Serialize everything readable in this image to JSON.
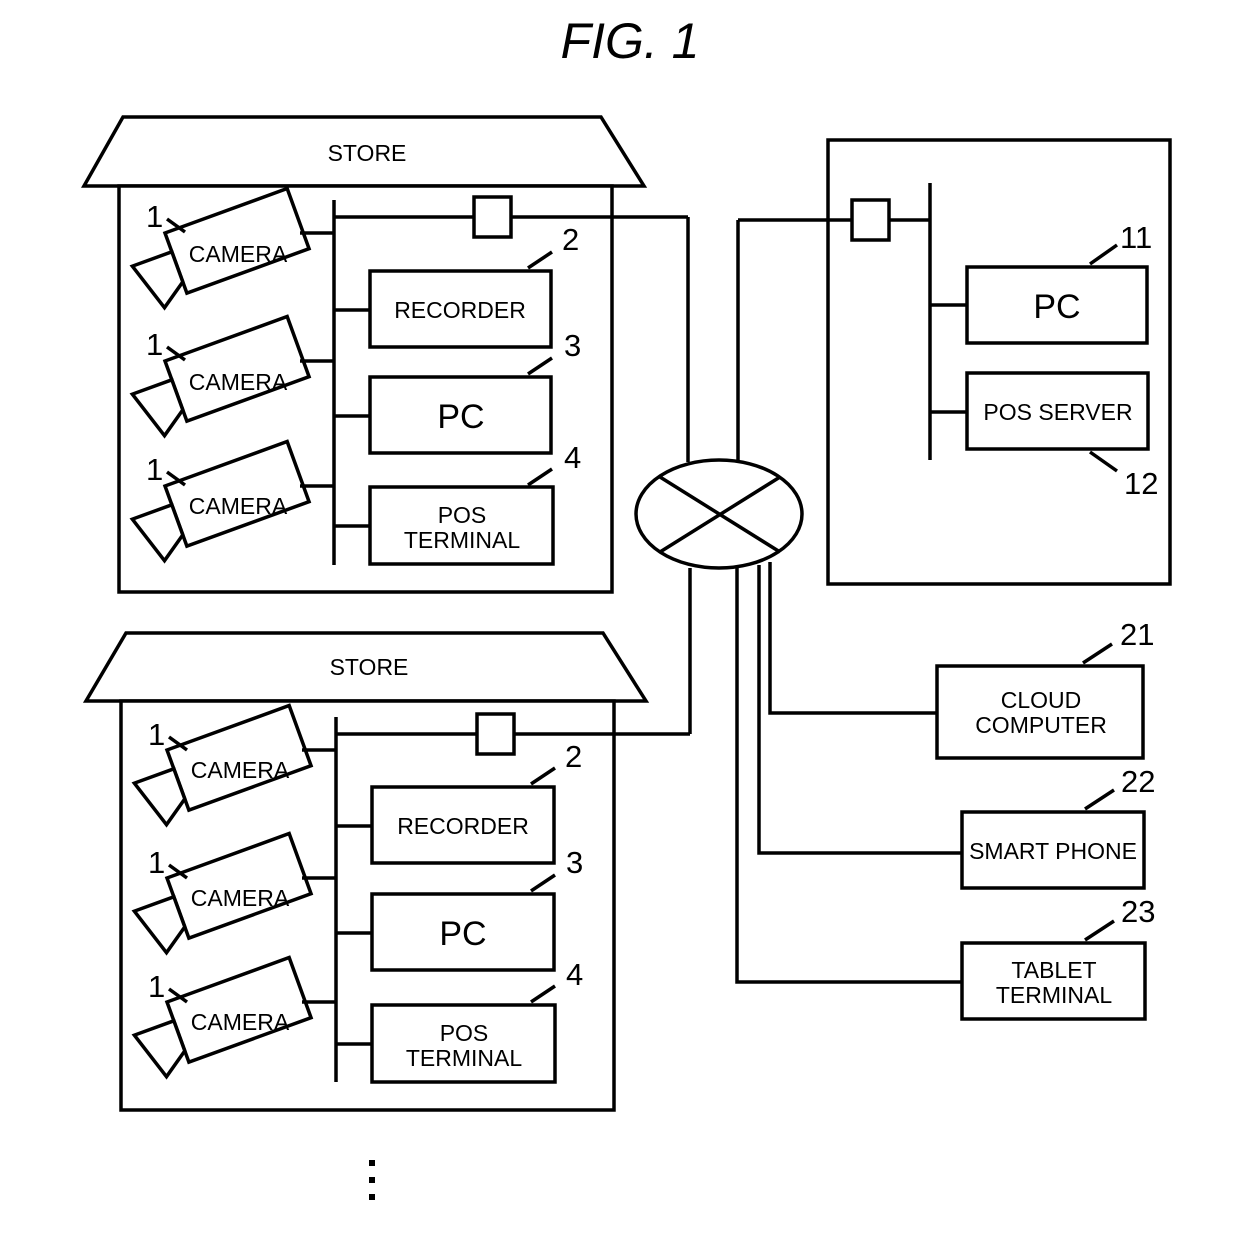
{
  "title": "FIG. 1",
  "stores": [
    {
      "label": "STORE",
      "cameras": [
        {
          "ref": "1",
          "label": "CAMERA"
        },
        {
          "ref": "1",
          "label": "CAMERA"
        },
        {
          "ref": "1",
          "label": "CAMERA"
        }
      ],
      "recorder": {
        "ref": "2",
        "label": "RECORDER"
      },
      "pc": {
        "ref": "3",
        "label": "PC"
      },
      "pos_terminal": {
        "ref": "4",
        "line1": "POS",
        "line2": "TERMINAL"
      }
    },
    {
      "label": "STORE",
      "cameras": [
        {
          "ref": "1",
          "label": "CAMERA"
        },
        {
          "ref": "1",
          "label": "CAMERA"
        },
        {
          "ref": "1",
          "label": "CAMERA"
        }
      ],
      "recorder": {
        "ref": "2",
        "label": "RECORDER"
      },
      "pc": {
        "ref": "3",
        "label": "PC"
      },
      "pos_terminal": {
        "ref": "4",
        "line1": "POS",
        "line2": "TERMINAL"
      }
    }
  ],
  "headquarters": {
    "pc": {
      "ref": "11",
      "label": "PC"
    },
    "pos_server": {
      "ref": "12",
      "label": "POS SERVER"
    }
  },
  "external": {
    "cloud_computer": {
      "ref": "21",
      "line1": "CLOUD",
      "line2": "COMPUTER"
    },
    "smart_phone": {
      "ref": "22",
      "label": "SMART PHONE"
    },
    "tablet_terminal": {
      "ref": "23",
      "line1": "TABLET",
      "line2": "TERMINAL"
    }
  },
  "continuation": "more stores (vertical ellipsis)"
}
